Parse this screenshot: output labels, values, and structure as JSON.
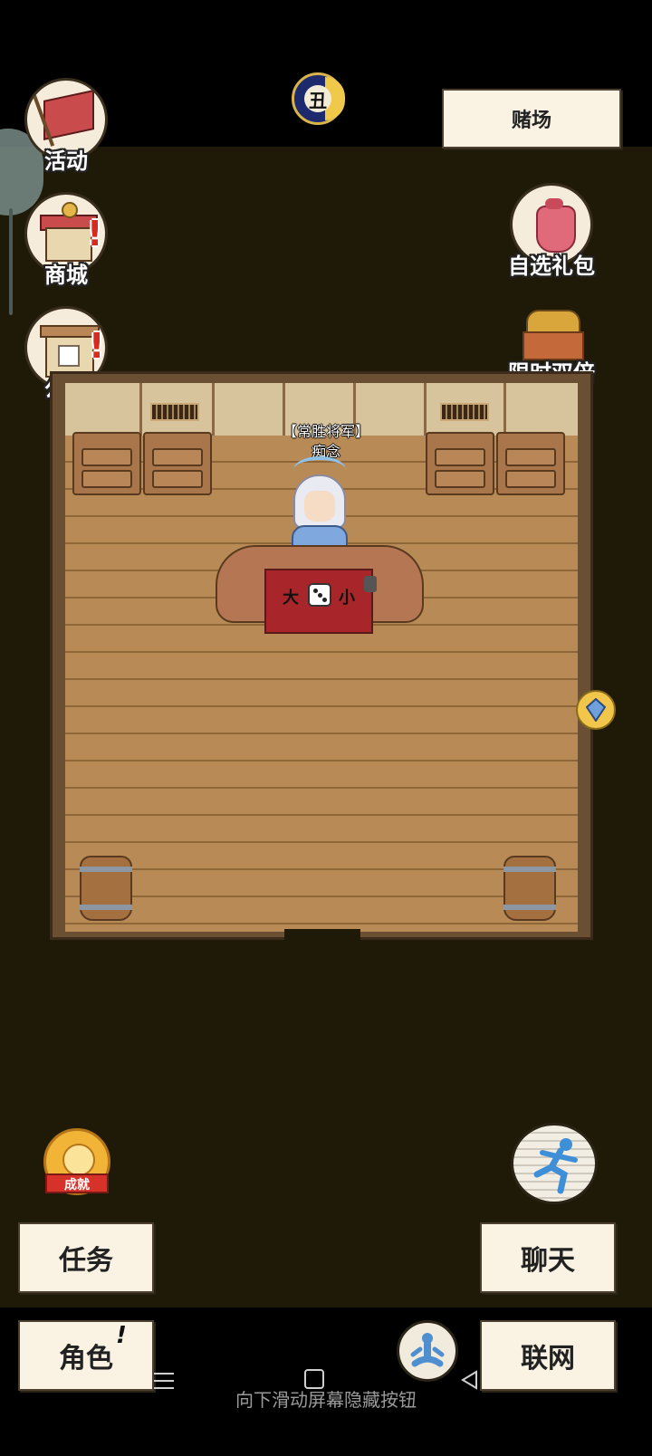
{
  "top": {
    "time_badge": "丑",
    "location_button": "赌场"
  },
  "left_menu": [
    {
      "label": "活动",
      "icon": "flag-icon"
    },
    {
      "label": "商城",
      "icon": "shop-icon",
      "alert": "!"
    },
    {
      "label": "公告",
      "icon": "notice-board-icon",
      "alert": "!"
    }
  ],
  "right_menu": [
    {
      "label": "自选礼包",
      "icon": "gift-bag-icon"
    },
    {
      "label": "限时双倍",
      "icon": "treasure-chest-icon"
    }
  ],
  "scene": {
    "npc_title": "【常胜将军】",
    "npc_name": "痴念",
    "table_left": "大",
    "table_right": "小"
  },
  "bottom": {
    "achievement_label": "成就",
    "quest_button": "任务",
    "chat_button": "聊天",
    "character_button": "角色",
    "character_alert": "!",
    "network_button": "联网"
  },
  "system": {
    "hint": "向下滑动屏幕隐藏按钮"
  }
}
